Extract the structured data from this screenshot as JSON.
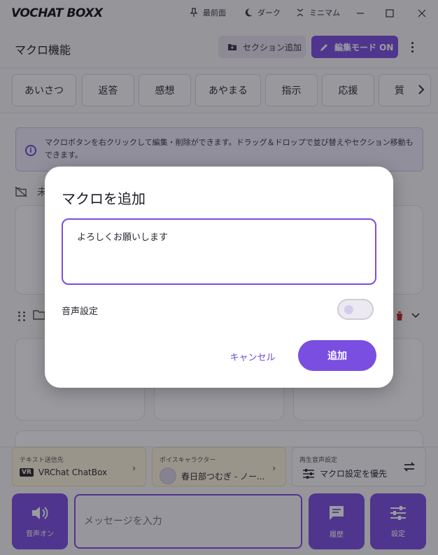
{
  "app": {
    "logo_text": "VOCHAT BOXX",
    "controls": {
      "pin_label": "最前面",
      "dark_label": "ダーク",
      "mini_label": "ミニマム"
    }
  },
  "header": {
    "title": "マクロ機能",
    "add_section_label": "セクション追加",
    "edit_mode_label": "編集モード ON"
  },
  "tabs": [
    {
      "label": "あいさつ"
    },
    {
      "label": "返答"
    },
    {
      "label": "感想"
    },
    {
      "label": "あやまる"
    },
    {
      "label": "指示"
    },
    {
      "label": "応援"
    },
    {
      "label": "質"
    }
  ],
  "info": {
    "text": "マクロボタンを右クリックして編集・削除ができます。ドラッグ＆ドロップで並び替えやセクション移動もできます。"
  },
  "category": {
    "partial_label": "未"
  },
  "bottom": {
    "text_target": {
      "caption": "テキスト送信先",
      "badge": "VR",
      "value": "VRChat ChatBox"
    },
    "voice_character": {
      "caption": "ボイスキャラクター",
      "value": "春日部つむぎ - ノー..."
    },
    "playback": {
      "caption": "再生音声設定",
      "value": "マクロ設定を優先"
    },
    "voice_on_label": "音声オン",
    "message_placeholder": "メッセージを入力",
    "history_label": "履歴",
    "settings_label": "設定"
  },
  "dialog": {
    "title": "マクロを追加",
    "text_value": "よろしくお願いします",
    "voice_setting_label": "音声設定",
    "voice_setting_on": false,
    "cancel_label": "キャンセル",
    "add_label": "追加"
  },
  "colors": {
    "accent": "#7a4ee0",
    "accent_text": "#6b4ad8",
    "info_bg": "#ece8f8",
    "text_target_bg": "#fbf3dd",
    "voice_char_bg": "#fbf3dd",
    "delete_icon": "#c0262c"
  }
}
